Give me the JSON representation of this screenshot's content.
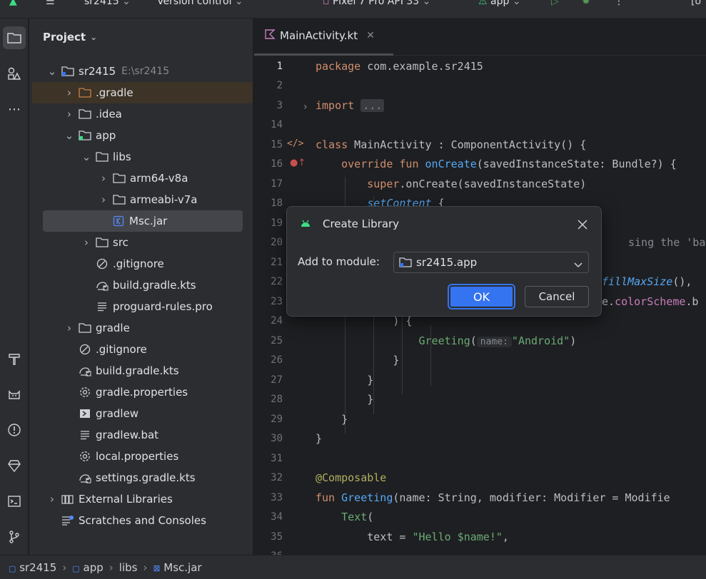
{
  "titlebar": {
    "project": "sr2415",
    "vcs": "Version control",
    "device": "Pixel 7 Pro API 33",
    "run_config": "app"
  },
  "project_panel": {
    "header": "Project",
    "tree": [
      {
        "label": "sr2415",
        "path": "E:\\sr2415",
        "icon": "module-folder-icon"
      },
      {
        "label": ".gradle",
        "icon": "folder-icon"
      },
      {
        "label": ".idea",
        "icon": "folder-icon"
      },
      {
        "label": "app",
        "icon": "module-folder-icon"
      },
      {
        "label": "libs",
        "icon": "folder-icon"
      },
      {
        "label": "arm64-v8a",
        "icon": "folder-icon"
      },
      {
        "label": "armeabi-v7a",
        "icon": "folder-icon"
      },
      {
        "label": "Msc.jar",
        "icon": "jar-icon"
      },
      {
        "label": "src",
        "icon": "folder-icon"
      },
      {
        "label": ".gitignore",
        "icon": "ignore-file-icon"
      },
      {
        "label": "build.gradle.kts",
        "icon": "gradle-file-icon"
      },
      {
        "label": "proguard-rules.pro",
        "icon": "text-file-icon"
      },
      {
        "label": "gradle",
        "icon": "folder-icon"
      },
      {
        "label": ".gitignore",
        "icon": "ignore-file-icon"
      },
      {
        "label": "build.gradle.kts",
        "icon": "gradle-file-icon"
      },
      {
        "label": "gradle.properties",
        "icon": "settings-file-icon"
      },
      {
        "label": "gradlew",
        "icon": "script-file-icon"
      },
      {
        "label": "gradlew.bat",
        "icon": "text-file-icon"
      },
      {
        "label": "local.properties",
        "icon": "settings-file-icon"
      },
      {
        "label": "settings.gradle.kts",
        "icon": "gradle-file-icon"
      },
      {
        "label": "External Libraries",
        "icon": "libraries-icon"
      },
      {
        "label": "Scratches and Consoles",
        "icon": "scratches-icon"
      }
    ]
  },
  "editor": {
    "tab": "MainActivity.kt",
    "line_numbers": [
      "1",
      "2",
      "3",
      "14",
      "15",
      "16",
      "17",
      "18",
      "19",
      "20",
      "21",
      "22",
      "23",
      "24",
      "25",
      "26",
      "27",
      "28",
      "29",
      "30",
      "31",
      "32",
      "33",
      "34",
      "35",
      "36"
    ],
    "code": {
      "l1_kw": "package",
      "l1_rest": " com.example.sr2415",
      "l3_kw": "import",
      "l3_fold": "...",
      "l15_kw": "class",
      "l15_rest": " MainActivity : ComponentActivity() {",
      "l16_indent": "    ",
      "l16_kw": "override fun",
      "l16_fn": "onCreate",
      "l16_rest": "(savedInstanceState: Bundle?) {",
      "l17_indent": "        ",
      "l17_kw": "super",
      "l17_rest": ".onCreate(savedInstanceState)",
      "l18_indent": "        ",
      "l18_it": "setContent",
      "l18_rest": " {",
      "l20_rest": "sing the 'backg",
      "l22_it": "fillMaxSize",
      "l22_rest": "(),",
      "l23_rest": "e.",
      "l23_purp": "colorScheme",
      "l23_rest2": ".b",
      "l24_text": "            ) {",
      "l25_indent": "                ",
      "l25_fn": "Greeting",
      "l25_paren": "(",
      "l25_hint": "name:",
      "l25_str": "\"Android\"",
      "l25_close": ")",
      "l26_text": "            }",
      "l27_text": "        }",
      "l28_text": "        }",
      "l29_text": "    }",
      "l30_text": "}",
      "l32_ann": "@Composable",
      "l33_kw": "fun",
      "l33_fn": "Greeting",
      "l33_rest": "(name: String, modifier: Modifier = Modifie",
      "l34_indent": "    ",
      "l34_fn": "Text",
      "l34_rest": "(",
      "l35_indent": "        ",
      "l35_rest": "text = ",
      "l35_str": "\"Hello $name!\"",
      "l35_tail": ","
    }
  },
  "dialog": {
    "title": "Create Library",
    "label": "Add to module:",
    "selected_module": "sr2415.app",
    "ok": "OK",
    "cancel": "Cancel"
  },
  "statusbar": {
    "crumbs": [
      "sr2415",
      "app",
      "libs",
      "Msc.jar"
    ]
  },
  "colors": {
    "accent": "#3574f0",
    "background": "#1e1f22",
    "panel": "#2b2d30",
    "keyword": "#cf8e6d",
    "function": "#56a8f5",
    "string": "#6aab73"
  }
}
